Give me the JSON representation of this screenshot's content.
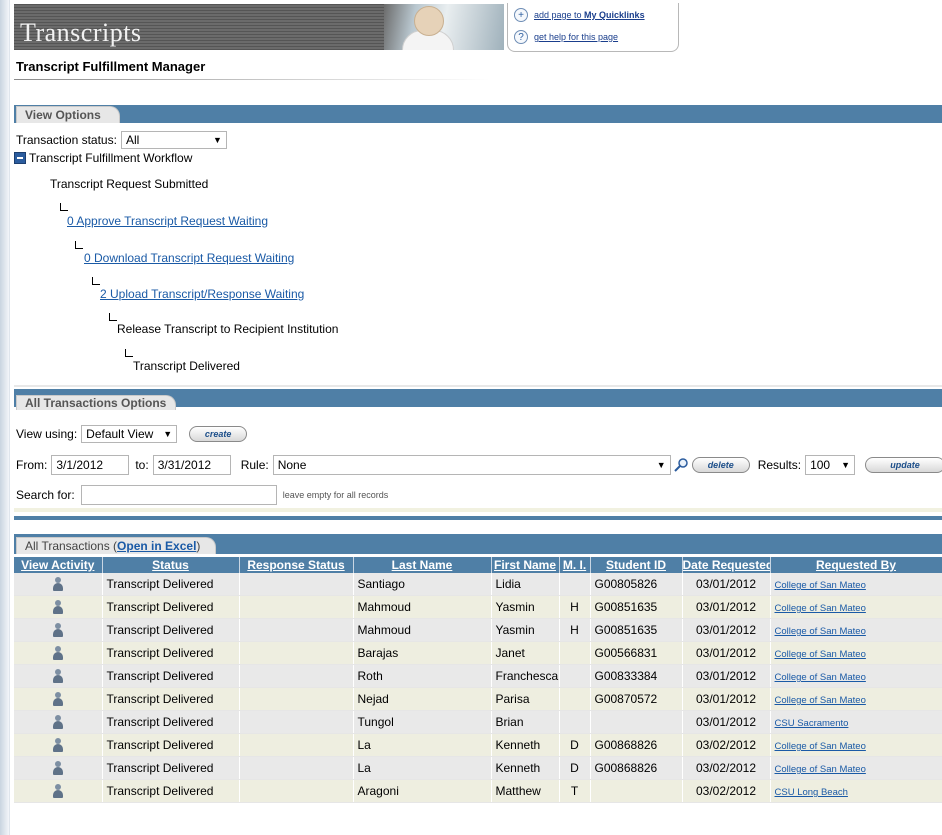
{
  "header": {
    "banner_title": "Transcripts",
    "page_title": "Transcript Fulfillment Manager",
    "quicklinks_prefix": "add page to ",
    "quicklinks_target": "My Quicklinks",
    "help_link": "get help for this page"
  },
  "view_options": {
    "tab_label": "View Options",
    "status_label": "Transaction status:",
    "status_value": "All",
    "workflow_title": "Transcript Fulfillment Workflow",
    "workflow_steps": [
      "Transcript Request Submitted",
      "0 Approve Transcript Request Waiting",
      "0 Download Transcript Request Waiting",
      "2 Upload Transcript/Response Waiting",
      "Release Transcript to Recipient Institution",
      "Transcript Delivered"
    ]
  },
  "options": {
    "tab_label": "All Transactions Options",
    "view_using_label": "View using:",
    "view_using_value": "Default View",
    "create_label": "create",
    "from_label": "From:",
    "from_value": "3/1/2012",
    "to_label": "to:",
    "to_value": "3/31/2012",
    "rule_label": "Rule:",
    "rule_value": "None",
    "delete_label": "delete",
    "results_label": "Results:",
    "results_value": "100",
    "update_label": "update",
    "search_label": "Search for:",
    "search_value": "",
    "search_hint": "leave empty for all records"
  },
  "transactions": {
    "tab_prefix": "All Transactions (",
    "excel_link": "Open in Excel",
    "tab_suffix": ")",
    "columns": [
      "View Activity",
      "Status",
      "Response Status",
      "Last Name",
      "First Name",
      "M. I.",
      "Student ID",
      "Date Requested",
      "Requested By"
    ],
    "rows": [
      [
        "Transcript Delivered",
        "",
        "Santiago",
        "Lidia",
        "",
        "G00805826",
        "03/01/2012",
        "College of San Mateo"
      ],
      [
        "Transcript Delivered",
        "",
        "Mahmoud",
        "Yasmin",
        "H",
        "G00851635",
        "03/01/2012",
        "College of San Mateo"
      ],
      [
        "Transcript Delivered",
        "",
        "Mahmoud",
        "Yasmin",
        "H",
        "G00851635",
        "03/01/2012",
        "College of San Mateo"
      ],
      [
        "Transcript Delivered",
        "",
        "Barajas",
        "Janet",
        "",
        "G00566831",
        "03/01/2012",
        "College of San Mateo"
      ],
      [
        "Transcript Delivered",
        "",
        "Roth",
        "Franchesca",
        "",
        "G00833384",
        "03/01/2012",
        "College of San Mateo"
      ],
      [
        "Transcript Delivered",
        "",
        "Nejad",
        "Parisa",
        "",
        "G00870572",
        "03/01/2012",
        "College of San Mateo"
      ],
      [
        "Transcript Delivered",
        "",
        "Tungol",
        "Brian",
        "",
        "",
        "03/01/2012",
        "CSU Sacramento"
      ],
      [
        "Transcript Delivered",
        "",
        "La",
        "Kenneth",
        "D",
        "G00868826",
        "03/02/2012",
        "College of San Mateo"
      ],
      [
        "Transcript Delivered",
        "",
        "La",
        "Kenneth",
        "D",
        "G00868826",
        "03/02/2012",
        "College of San Mateo"
      ],
      [
        "Transcript Delivered",
        "",
        "Aragoni",
        "Matthew",
        "T",
        "",
        "03/02/2012",
        "CSU Long Beach"
      ]
    ]
  },
  "colors": {
    "bar_blue": "#4f7fa6",
    "link_blue": "#1a5aa6",
    "row_odd": "#e9e9e9",
    "row_even": "#eeeee0"
  }
}
